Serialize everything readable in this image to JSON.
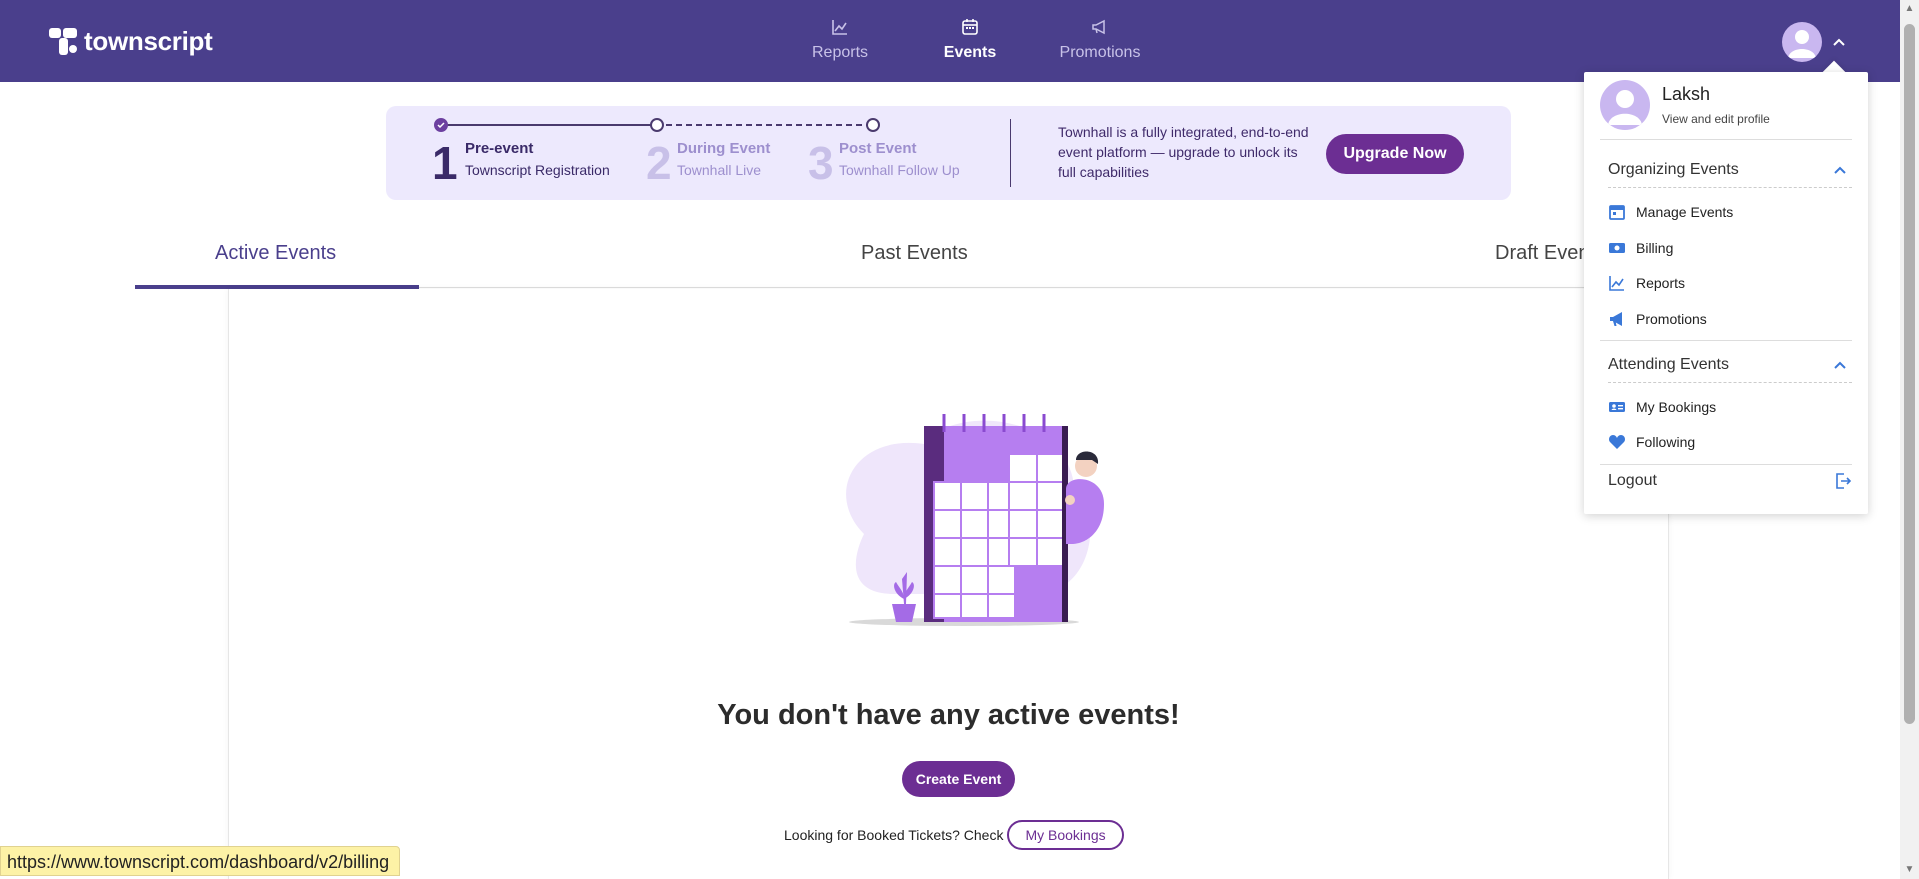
{
  "header": {
    "logo_text": "townscript",
    "nav": [
      {
        "label": "Reports",
        "icon": "chart-line-icon"
      },
      {
        "label": "Events",
        "icon": "calendar-icon",
        "active": true
      },
      {
        "label": "Promotions",
        "icon": "megaphone-icon"
      }
    ]
  },
  "banner": {
    "steps": [
      {
        "number": "1",
        "title": "Pre-event",
        "subtitle": "Townscript Registration"
      },
      {
        "number": "2",
        "title": "During Event",
        "subtitle": "Townhall Live"
      },
      {
        "number": "3",
        "title": "Post Event",
        "subtitle": "Townhall Follow Up"
      }
    ],
    "text": "Townhall is a fully integrated, end-to-end event platform — upgrade to unlock its full capabilities",
    "upgrade_label": "Upgrade Now"
  },
  "tabs": {
    "active": "Active Events",
    "past": "Past Events",
    "draft": "Draft Even"
  },
  "empty_state": {
    "title": "You don't have any active events!",
    "create_label": "Create Event",
    "booked_text": "Looking for Booked Tickets? Check",
    "my_bookings_label": "My Bookings"
  },
  "status_url": "https://www.townscript.com/dashboard/v2/billing",
  "dropdown": {
    "name": "Laksh",
    "view_edit": "View and edit profile",
    "organizing": {
      "label": "Organizing Events",
      "items": [
        {
          "label": "Manage Events",
          "icon": "calendar-icon"
        },
        {
          "label": "Billing",
          "icon": "money-icon"
        },
        {
          "label": "Reports",
          "icon": "chart-line-icon"
        },
        {
          "label": "Promotions",
          "icon": "megaphone-icon"
        }
      ]
    },
    "attending": {
      "label": "Attending Events",
      "items": [
        {
          "label": "My Bookings",
          "icon": "ticket-icon"
        },
        {
          "label": "Following",
          "icon": "heart-icon"
        }
      ]
    },
    "logout": "Logout"
  },
  "colors": {
    "brand": "#4a3f8c",
    "accent": "#6c2e93",
    "banner_bg": "#ede9fd",
    "link_blue": "#3a78d8"
  }
}
